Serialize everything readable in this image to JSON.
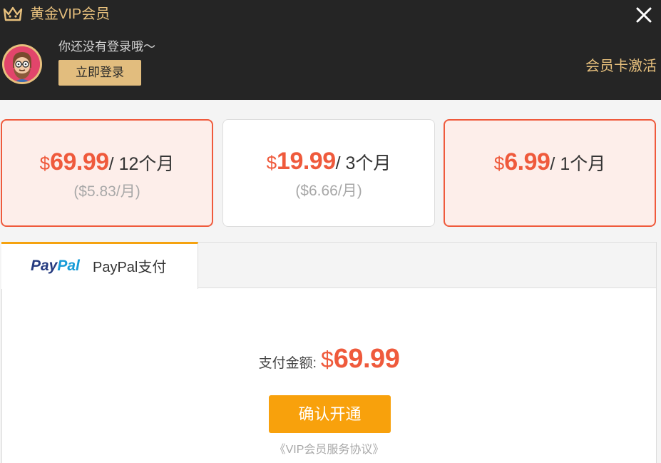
{
  "header": {
    "title": "黄金VIP会员",
    "login_hint": "你还没有登录哦～",
    "login_button": "立即登录",
    "activate_card": "会员卡激活",
    "brand_color": "#e7c07d"
  },
  "plans": [
    {
      "currency": "$",
      "price": "69.99",
      "period": "/ 12个月",
      "monthly": "($5.83/月)",
      "selected": true
    },
    {
      "currency": "$",
      "price": "19.99",
      "period": "/ 3个月",
      "monthly": "($6.66/月)",
      "selected": false
    },
    {
      "currency": "$",
      "price": "6.99",
      "period": "/ 1个月",
      "monthly": "",
      "selected": true
    }
  ],
  "payment": {
    "tab_logo_pay": "Pay",
    "tab_logo_pal": "Pal",
    "tab_label": "PayPal支付",
    "amount_label": "支付金额:",
    "amount_currency": "$",
    "amount_value": "69.99",
    "confirm_button": "确认开通",
    "agreement_link": "《VIP会员服务协议》"
  },
  "colors": {
    "accent_red": "#ef5a3c",
    "confirm_orange": "#f8a10c",
    "header_bg": "#252525"
  }
}
